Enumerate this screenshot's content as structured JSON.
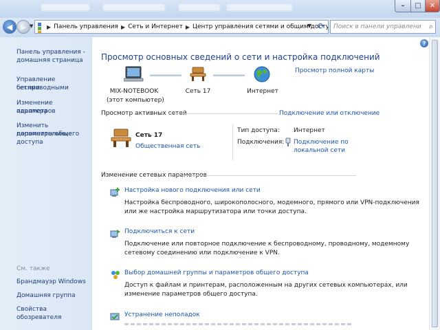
{
  "window": {
    "buttons": {
      "minimize": "–",
      "maximize": "□",
      "close": "✕"
    }
  },
  "navbar": {
    "breadcrumbs": [
      "Панель управления",
      "Сеть и Интернет",
      "Центр управления сетями и общим доступом"
    ],
    "search_placeholder": "Поиск в панели управления"
  },
  "sidebar": {
    "links": [
      "Панель управления -",
      "домашняя страница",
      "Управление беспроводными",
      "сетями",
      "Изменение параметров",
      "адаптера",
      "Изменить дополнительные",
      "параметры общего доступа"
    ],
    "see_also_label": "См. также",
    "see_also": [
      "Брандмауэр Windows",
      "Домашняя группа",
      "Свойства обозревателя"
    ]
  },
  "main": {
    "title": "Просмотр основных сведений о сети и настройка подключений",
    "full_map_link": "Просмотр полной карты",
    "map": {
      "computer_name": "MIX-NOTEBOOK",
      "computer_sub": "(этот компьютер)",
      "network_name": "Сеть  17",
      "internet": "Интернет"
    },
    "active_header": "Просмотр активных сетей",
    "connect_link": "Подключение или отключение",
    "active_network": {
      "name": "Сеть  17",
      "type_link": "Общественная сеть",
      "access_label": "Тип доступа:",
      "access_value": "Интернет",
      "connections_label": "Подключения:",
      "connection_line1": "Подключение по",
      "connection_line2": "локальной сети"
    },
    "change_header": "Изменение сетевых параметров",
    "tasks": [
      {
        "title": "Настройка нового подключения или сети",
        "desc1": "Настройка беспроводного, широкополосного, модемного, прямого или VPN-подключения",
        "desc2": "или же настройка маршрутизатора или точки доступа."
      },
      {
        "title": "Подключиться к сети",
        "desc1": "Подключение или повторное подключение к беспроводному, проводному, модемному",
        "desc2": "сетевому соединению или подключение к VPN."
      },
      {
        "title": "Выбор домашней группы и параметров общего доступа",
        "desc1": "Доступ к файлам и принтерам, расположенным на других сетевых компьютерах, или",
        "desc2": "изменение параметров общего доступа."
      },
      {
        "title": "Устранение неполадок",
        "desc1": "",
        "desc2": ""
      }
    ]
  },
  "colors": {
    "link": "#1a55b0",
    "title": "#1e3f8a",
    "sidebar_bg": "#dbe7f6"
  }
}
